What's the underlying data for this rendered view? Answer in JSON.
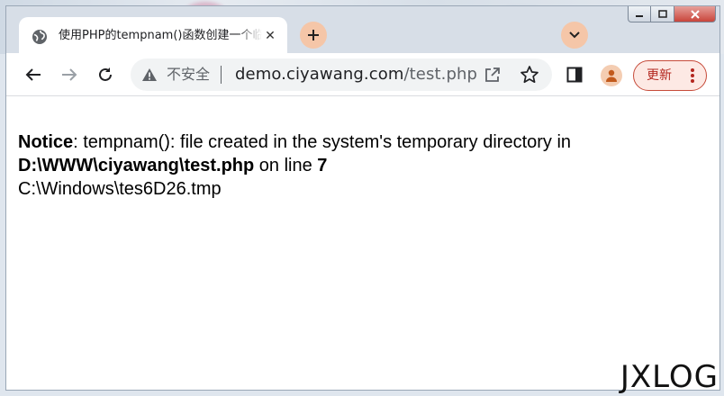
{
  "tab": {
    "title": "使用PHP的tempnam()函数创建一个临时文件",
    "close_icon": "close-icon",
    "favicon": "globe-icon"
  },
  "toolbar": {
    "security_label": "不安全",
    "url_host": "demo.ciyawang.com",
    "url_path": "/test.php",
    "update_label": "更新"
  },
  "notice": {
    "heading": "Notice",
    "message": ": tempnam(): file created in the system's temporary directory in ",
    "path": "D:\\WWW\\ciyawang\\test.php",
    "line_text": " on line ",
    "line_number": "7",
    "output": "C:\\Windows\\tes6D26.tmp"
  },
  "watermark": "JXLOG",
  "colors": {
    "accent_peach": "#f5c6a8",
    "update_red": "#c64b3a",
    "toolbar_bg": "#ffffff",
    "frame_bg": "#d7dee7"
  }
}
